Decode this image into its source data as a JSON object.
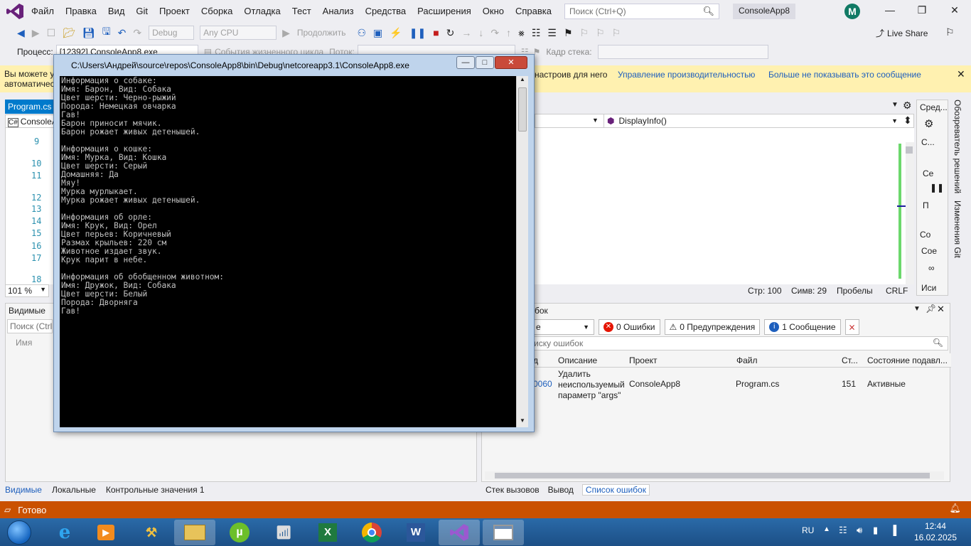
{
  "menu": {
    "items": [
      "Файл",
      "Правка",
      "Вид",
      "Git",
      "Проект",
      "Сборка",
      "Отладка",
      "Тест",
      "Анализ",
      "Средства",
      "Расширения",
      "Окно",
      "Справка"
    ],
    "search_placeholder": "Поиск (Ctrl+Q)",
    "project_name": "ConsoleApp8",
    "avatar_letter": "M"
  },
  "toolbar": {
    "config": "Debug",
    "platform": "Any CPU",
    "continue_label": "Продолжить",
    "live_share": "Live Share"
  },
  "toolbar2": {
    "process_label": "Процесс:",
    "process_value": "[12392] ConsoleApp8.exe",
    "lifecycle_label": "События жизненного цикла",
    "thread_label": "Поток:",
    "frame_label": "Кадр стека:"
  },
  "infobar": {
    "text_line1": "Вы можете у",
    "text_line2": "автоматичес",
    "text_right": "настроив для него",
    "link1": "Управление производительностью",
    "link2": "Больше не показывать это сообщение"
  },
  "editor": {
    "file_tab": "Program.cs",
    "scope_dropdown": "ConsoleA",
    "line_numbers": [
      "9",
      "10",
      "11",
      "12",
      "13",
      "14",
      "15",
      "16",
      "17",
      "18"
    ],
    "zoom": "101 %",
    "member_dropdown": "DisplayInfo()",
    "status_line": "Стр: 100",
    "status_col": "Симв: 29",
    "status_ws": "Пробелы",
    "status_eol": "CRLF"
  },
  "watch": {
    "title": "Видимые",
    "search_placeholder": "Поиск (Ctrl",
    "column_name": "Имя",
    "tabs": [
      "Видимые",
      "Локальные",
      "Контрольные значения 1"
    ]
  },
  "errors": {
    "title_partial": "бок",
    "filter_value": "е",
    "errors_btn": "0 Ошибки",
    "warnings_btn": "0 Предупреждения",
    "messages_btn": "1 Сообщение",
    "search_placeholder": "иску ошибок",
    "columns": [
      "д",
      "Описание",
      "Проект",
      "Файл",
      "Ст...",
      "Состояние подавл..."
    ],
    "rows": [
      {
        "code": "0060",
        "description_lines": [
          "Удалить",
          "неиспользуемый",
          "параметр \"args\""
        ],
        "project": "ConsoleApp8",
        "file": "Program.cs",
        "line": "151",
        "state": "Активные"
      }
    ],
    "tabs": [
      "Стек вызовов",
      "Вывод",
      "Список ошибок"
    ]
  },
  "side_panel": {
    "header": "Сред...",
    "items": [
      "С...",
      "Се",
      "П",
      "Со",
      "Сое",
      "Иси"
    ],
    "vertical_tabs": [
      "Обозреватель решений",
      "Изменения Git"
    ]
  },
  "console": {
    "title": "C:\\Users\\Андрей\\source\\repos\\ConsoleApp8\\bin\\Debug\\netcoreapp3.1\\ConsoleApp8.exe",
    "lines": [
      "Информация о собаке:",
      "Имя: Барон, Вид: Собака",
      "Цвет шерсти: Черно-рыжий",
      "Порода: Немецкая овчарка",
      "Гав!",
      "Барон приносит мячик.",
      "Барон рожает живых детенышей.",
      "",
      "Информация о кошке:",
      "Имя: Мурка, Вид: Кошка",
      "Цвет шерсти: Серый",
      "Домашняя: Да",
      "Мяу!",
      "Мурка мурлыкает.",
      "Мурка рожает живых детенышей.",
      "",
      "Информация об орле:",
      "Имя: Крук, Вид: Орел",
      "Цвет перьев: Коричневый",
      "Размах крыльев: 220 см",
      "Животное издает звук.",
      "Крук парит в небе.",
      "",
      "Информация об обобщенном животном:",
      "Имя: Дружок, Вид: Собака",
      "Цвет шерсти: Белый",
      "Порода: Дворняга",
      "Гав!"
    ]
  },
  "status": {
    "text": "Готово"
  },
  "taskbar": {
    "language": "RU",
    "time": "12:44",
    "date": "16.02.2025"
  },
  "colors": {
    "accent": "#007acc",
    "statusbar": "#ca5100",
    "infobar": "#fff1b0",
    "vs_purple": "#68217a"
  }
}
